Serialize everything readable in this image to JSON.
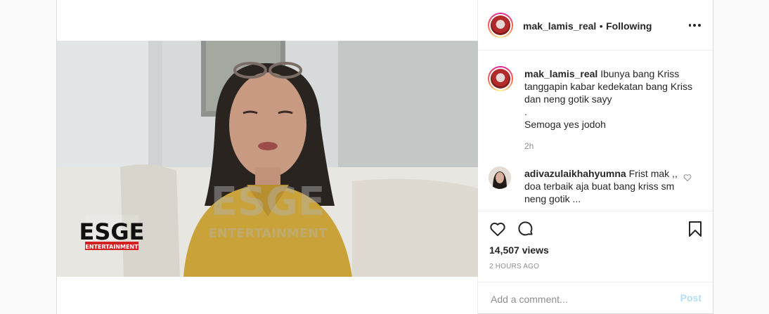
{
  "header": {
    "username": "mak_lamis_real",
    "separator": "•",
    "follow_status": "Following"
  },
  "video": {
    "watermark_center_top": "ESGE",
    "watermark_center_bottom": "ENTERTAINMENT",
    "logo_top": "ESGE",
    "logo_bottom": "ENTERTAINMENT"
  },
  "caption": {
    "username": "mak_lamis_real",
    "text": "Ibunya bang Kriss tanggapin kabar kedekatan bang Kriss dan neng gotik sayy",
    "line2": ".",
    "line3": "Semoga yes jodoh",
    "time": "2h"
  },
  "comments": [
    {
      "username": "adivazulaikhahyumna",
      "text": "Frist mak ,, doa terbaik aja buat bang kriss sm neng gotik ..."
    }
  ],
  "stats": {
    "views": "14,507 views",
    "date": "2 HOURS AGO"
  },
  "add_comment": {
    "placeholder": "Add a comment...",
    "post_label": "Post"
  },
  "colors": {
    "post_button_disabled": "#b2dffc",
    "secondary_text": "#8e8e8e",
    "border": "#efefef"
  }
}
